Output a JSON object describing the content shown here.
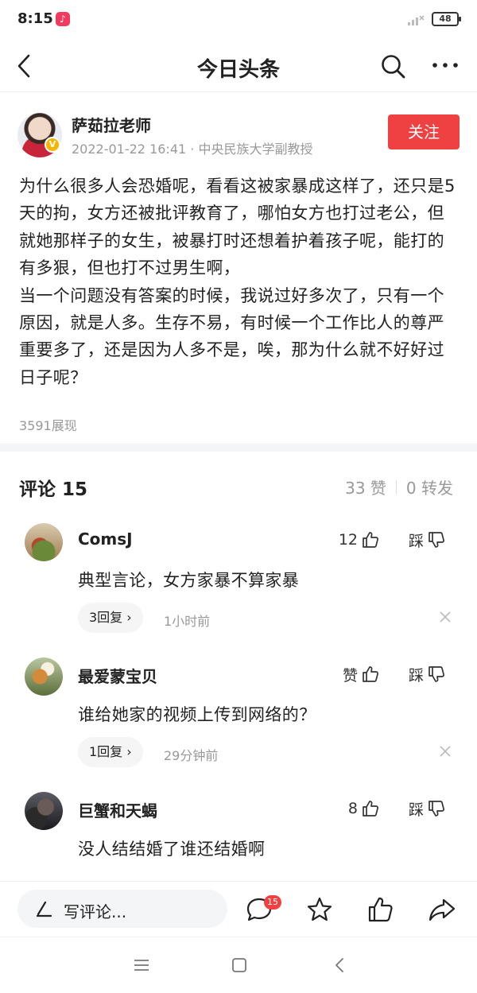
{
  "status_bar": {
    "time": "8:15",
    "battery": "48",
    "app_icon": "tiktok-icon"
  },
  "header": {
    "title": "今日头条",
    "icons": [
      "back-icon",
      "search-icon",
      "more-icon"
    ]
  },
  "author": {
    "name": "萨茹拉老师",
    "meta": "2022-01-22 16:41 · 中央民族大学副教授",
    "follow_label": "关注",
    "verified_badge": "V"
  },
  "post": {
    "body": "为什么很多人会恐婚呢，看看这被家暴成这样了，还只是5天的拘，女方还被批评教育了，哪怕女方也打过老公，但就她那样子的女生，被暴打时还想着护着孩子呢，能打的有多狠，但也打不过男生啊，\n当一个问题没有答案的时候，我说过好多次了，只有一个原因，就是人多。生存不易，有时候一个工作比人的尊严重要多了，还是因为人多不是，唉，那为什么就不好好过日子呢？",
    "views": "3591展现"
  },
  "comments_section": {
    "title": "评论 15",
    "likes": "33 赞",
    "shares": "0 转发"
  },
  "comments": [
    {
      "name": "ComsJ",
      "like": "12",
      "dislike": "踩",
      "text": "典型言论，女方家暴不算家暴",
      "reply": "3回复 ›",
      "time": "1小时前"
    },
    {
      "name": "最爱蒙宝贝",
      "like": "赞",
      "dislike": "踩",
      "text": "谁给她家的视频上传到网络的？",
      "reply": "1回复 ›",
      "time": "29分钟前"
    },
    {
      "name": "巨蟹和天蝎",
      "like": "8",
      "dislike": "踩",
      "text": "没人结结婚了谁还结婚啊"
    }
  ],
  "toolbar": {
    "write_label": "写评论...",
    "comment_count": "15",
    "icons": [
      "comment-icon",
      "star-icon",
      "thumbs-up-icon",
      "share-icon"
    ]
  },
  "colors": {
    "accent": "#f04142",
    "muted": "#999999"
  }
}
